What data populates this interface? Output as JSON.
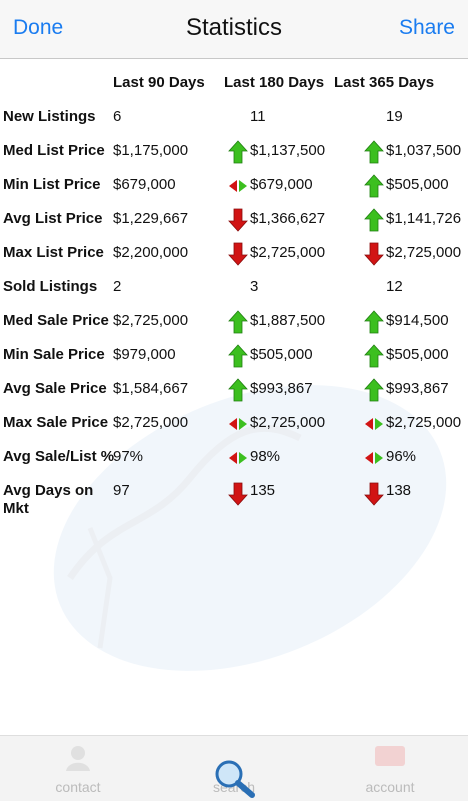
{
  "nav": {
    "left": "Done",
    "title": "Statistics",
    "right": "Share"
  },
  "columns": [
    "Last 90 Days",
    "Last 180 Days",
    "Last 365 Days"
  ],
  "rows": [
    {
      "label": "New Listings",
      "v90": "6",
      "a180": "",
      "v180": "11",
      "a365": "",
      "v365": "19"
    },
    {
      "label": "Med List Price",
      "v90": "$1,175,000",
      "a180": "up",
      "v180": "$1,137,500",
      "a365": "up",
      "v365": "$1,037,500"
    },
    {
      "label": "Min List Price",
      "v90": "$679,000",
      "a180": "flat",
      "v180": "$679,000",
      "a365": "up",
      "v365": "$505,000"
    },
    {
      "label": "Avg List Price",
      "v90": "$1,229,667",
      "a180": "down",
      "v180": "$1,366,627",
      "a365": "up",
      "v365": "$1,141,726"
    },
    {
      "label": "Max List Price",
      "v90": "$2,200,000",
      "a180": "down",
      "v180": "$2,725,000",
      "a365": "down",
      "v365": "$2,725,000"
    },
    {
      "label": "Sold Listings",
      "v90": "2",
      "a180": "",
      "v180": "3",
      "a365": "",
      "v365": "12"
    },
    {
      "label": "Med Sale Price",
      "v90": "$2,725,000",
      "a180": "up",
      "v180": "$1,887,500",
      "a365": "up",
      "v365": "$914,500"
    },
    {
      "label": "Min Sale Price",
      "v90": "$979,000",
      "a180": "up",
      "v180": "$505,000",
      "a365": "up",
      "v365": "$505,000"
    },
    {
      "label": "Avg Sale Price",
      "v90": "$1,584,667",
      "a180": "up",
      "v180": "$993,867",
      "a365": "up",
      "v365": "$993,867"
    },
    {
      "label": "Max Sale Price",
      "v90": "$2,725,000",
      "a180": "flat",
      "v180": "$2,725,000",
      "a365": "flat",
      "v365": "$2,725,000"
    },
    {
      "label": "Avg Sale/List %",
      "v90": "97%",
      "a180": "flat",
      "v180": "98%",
      "a365": "flat",
      "v365": "96%"
    },
    {
      "label": "Avg Days on Mkt",
      "v90": "97",
      "a180": "down",
      "v180": "135",
      "a365": "down",
      "v365": "138"
    }
  ],
  "tabs": [
    {
      "label": "contact",
      "icon": "contact-icon"
    },
    {
      "label": "search",
      "icon": "search-magnifier-icon"
    },
    {
      "label": "account",
      "icon": "account-icon"
    }
  ],
  "colors": {
    "accent": "#1a7cf0",
    "up": "#3cbf1f",
    "down": "#d11414"
  }
}
